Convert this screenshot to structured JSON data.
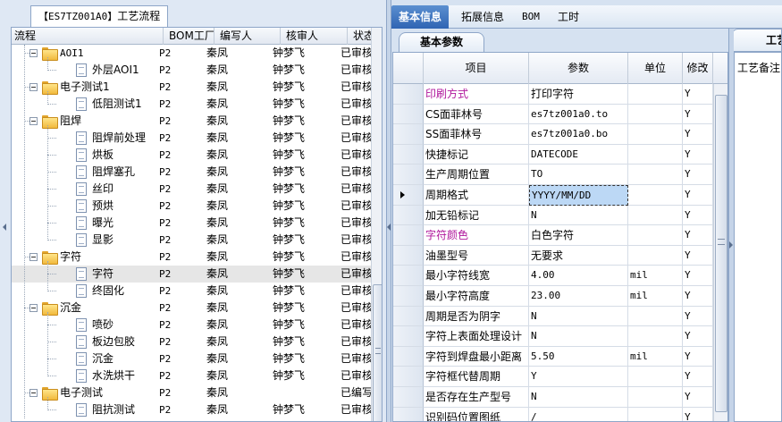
{
  "left": {
    "tab_code": "【ES7TZ001A0】",
    "tab_label": "工艺流程",
    "columns": [
      "流程",
      "BOM工厂",
      "编写人",
      "核审人",
      "状态"
    ],
    "rows": [
      {
        "label": "AOI1",
        "level": 0,
        "type": "folder",
        "mono": true,
        "bom": "P2",
        "writer": "秦凤",
        "reviewer": "钟梦飞",
        "status": "已审核"
      },
      {
        "label": "外层AOI1",
        "level": 1,
        "type": "doc",
        "bom": "P2",
        "writer": "秦凤",
        "reviewer": "钟梦飞",
        "status": "已审核"
      },
      {
        "label": "电子测试1",
        "level": 0,
        "type": "folder",
        "bom": "P2",
        "writer": "秦凤",
        "reviewer": "钟梦飞",
        "status": "已审核"
      },
      {
        "label": "低阻测试1",
        "level": 1,
        "type": "doc",
        "bom": "P2",
        "writer": "秦凤",
        "reviewer": "钟梦飞",
        "status": "已审核"
      },
      {
        "label": "阻焊",
        "level": 0,
        "type": "folder",
        "bom": "P2",
        "writer": "秦凤",
        "reviewer": "钟梦飞",
        "status": "已审核"
      },
      {
        "label": "阻焊前处理",
        "level": 1,
        "type": "doc",
        "bom": "P2",
        "writer": "秦凤",
        "reviewer": "钟梦飞",
        "status": "已审核"
      },
      {
        "label": "烘板",
        "level": 1,
        "type": "doc",
        "bom": "P2",
        "writer": "秦凤",
        "reviewer": "钟梦飞",
        "status": "已审核"
      },
      {
        "label": "阻焊塞孔",
        "level": 1,
        "type": "doc",
        "bom": "P2",
        "writer": "秦凤",
        "reviewer": "钟梦飞",
        "status": "已审核"
      },
      {
        "label": "丝印",
        "level": 1,
        "type": "doc",
        "bom": "P2",
        "writer": "秦凤",
        "reviewer": "钟梦飞",
        "status": "已审核"
      },
      {
        "label": "预烘",
        "level": 1,
        "type": "doc",
        "bom": "P2",
        "writer": "秦凤",
        "reviewer": "钟梦飞",
        "status": "已审核"
      },
      {
        "label": "曝光",
        "level": 1,
        "type": "doc",
        "bom": "P2",
        "writer": "秦凤",
        "reviewer": "钟梦飞",
        "status": "已审核"
      },
      {
        "label": "显影",
        "level": 1,
        "type": "doc",
        "bom": "P2",
        "writer": "秦凤",
        "reviewer": "钟梦飞",
        "status": "已审核"
      },
      {
        "label": "字符",
        "level": 0,
        "type": "folder",
        "bom": "P2",
        "writer": "秦凤",
        "reviewer": "钟梦飞",
        "status": "已审核"
      },
      {
        "label": "字符",
        "level": 1,
        "type": "doc",
        "selected": true,
        "bom": "P2",
        "writer": "秦凤",
        "reviewer": "钟梦飞",
        "status": "已审核"
      },
      {
        "label": "终固化",
        "level": 1,
        "type": "doc",
        "bom": "P2",
        "writer": "秦凤",
        "reviewer": "钟梦飞",
        "status": "已审核"
      },
      {
        "label": "沉金",
        "level": 0,
        "type": "folder",
        "bom": "P2",
        "writer": "秦凤",
        "reviewer": "钟梦飞",
        "status": "已审核"
      },
      {
        "label": "喷砂",
        "level": 1,
        "type": "doc",
        "bom": "P2",
        "writer": "秦凤",
        "reviewer": "钟梦飞",
        "status": "已审核"
      },
      {
        "label": "板边包胶",
        "level": 1,
        "type": "doc",
        "bom": "P2",
        "writer": "秦凤",
        "reviewer": "钟梦飞",
        "status": "已审核"
      },
      {
        "label": "沉金",
        "level": 1,
        "type": "doc",
        "bom": "P2",
        "writer": "秦凤",
        "reviewer": "钟梦飞",
        "status": "已审核"
      },
      {
        "label": "水洗烘干",
        "level": 1,
        "type": "doc",
        "bom": "P2",
        "writer": "秦凤",
        "reviewer": "钟梦飞",
        "status": "已审核"
      },
      {
        "label": "电子测试",
        "level": 0,
        "type": "folder",
        "bom": "P2",
        "writer": "秦凤",
        "reviewer": "",
        "status": "已编写"
      },
      {
        "label": "阻抗测试",
        "level": 1,
        "type": "doc",
        "bom": "P2",
        "writer": "秦凤",
        "reviewer": "钟梦飞",
        "status": "已审核"
      }
    ]
  },
  "right": {
    "tabs": [
      "基本信息",
      "拓展信息",
      "BOM",
      "工时"
    ],
    "active_tab": 0,
    "sub_tab": "基本参数",
    "side_tab": "工艺",
    "remark_label": "工艺备注",
    "columns": [
      "项目",
      "参数",
      "单位",
      "修改"
    ],
    "rows": [
      {
        "item": "印刷方式",
        "param": "打印字符",
        "unit": "",
        "mod": "Y",
        "purple": true
      },
      {
        "item": "CS面菲林号",
        "param": "es7tz001a0.to",
        "unit": "",
        "mod": "Y",
        "mono": true
      },
      {
        "item": "SS面菲林号",
        "param": "es7tz001a0.bo",
        "unit": "",
        "mod": "Y",
        "mono": true
      },
      {
        "item": "快捷标记",
        "param": "DATECODE",
        "unit": "",
        "mod": "Y",
        "mono": true
      },
      {
        "item": "生产周期位置",
        "param": "TO",
        "unit": "",
        "mod": "Y",
        "mono": true
      },
      {
        "item": "周期格式",
        "param": "YYYY/MM/DD",
        "unit": "",
        "mod": "Y",
        "mono": true,
        "current": true
      },
      {
        "item": "加无铅标记",
        "param": "N",
        "unit": "",
        "mod": "Y",
        "mono": true
      },
      {
        "item": "字符颜色",
        "param": "白色字符",
        "unit": "",
        "mod": "Y",
        "purple": true
      },
      {
        "item": "油墨型号",
        "param": "无要求",
        "unit": "",
        "mod": "Y"
      },
      {
        "item": "最小字符线宽",
        "param": "4.00",
        "unit": "mil",
        "mod": "Y",
        "mono": true
      },
      {
        "item": "最小字符高度",
        "param": "23.00",
        "unit": "mil",
        "mod": "Y",
        "mono": true
      },
      {
        "item": "周期是否为阴字",
        "param": "N",
        "unit": "",
        "mod": "Y",
        "mono": true
      },
      {
        "item": "字符上表面处理设计",
        "param": "N",
        "unit": "",
        "mod": "Y",
        "mono": true
      },
      {
        "item": "字符到焊盘最小距离",
        "param": "5.50",
        "unit": "mil",
        "mod": "Y",
        "mono": true
      },
      {
        "item": "字符框代替周期",
        "param": "Y",
        "unit": "",
        "mod": "Y",
        "mono": true
      },
      {
        "item": "是否存在生产型号",
        "param": "N",
        "unit": "",
        "mod": "Y",
        "mono": true
      },
      {
        "item": "识别码位置图纸",
        "param": "/",
        "unit": "",
        "mod": "Y",
        "mono": true
      }
    ]
  }
}
